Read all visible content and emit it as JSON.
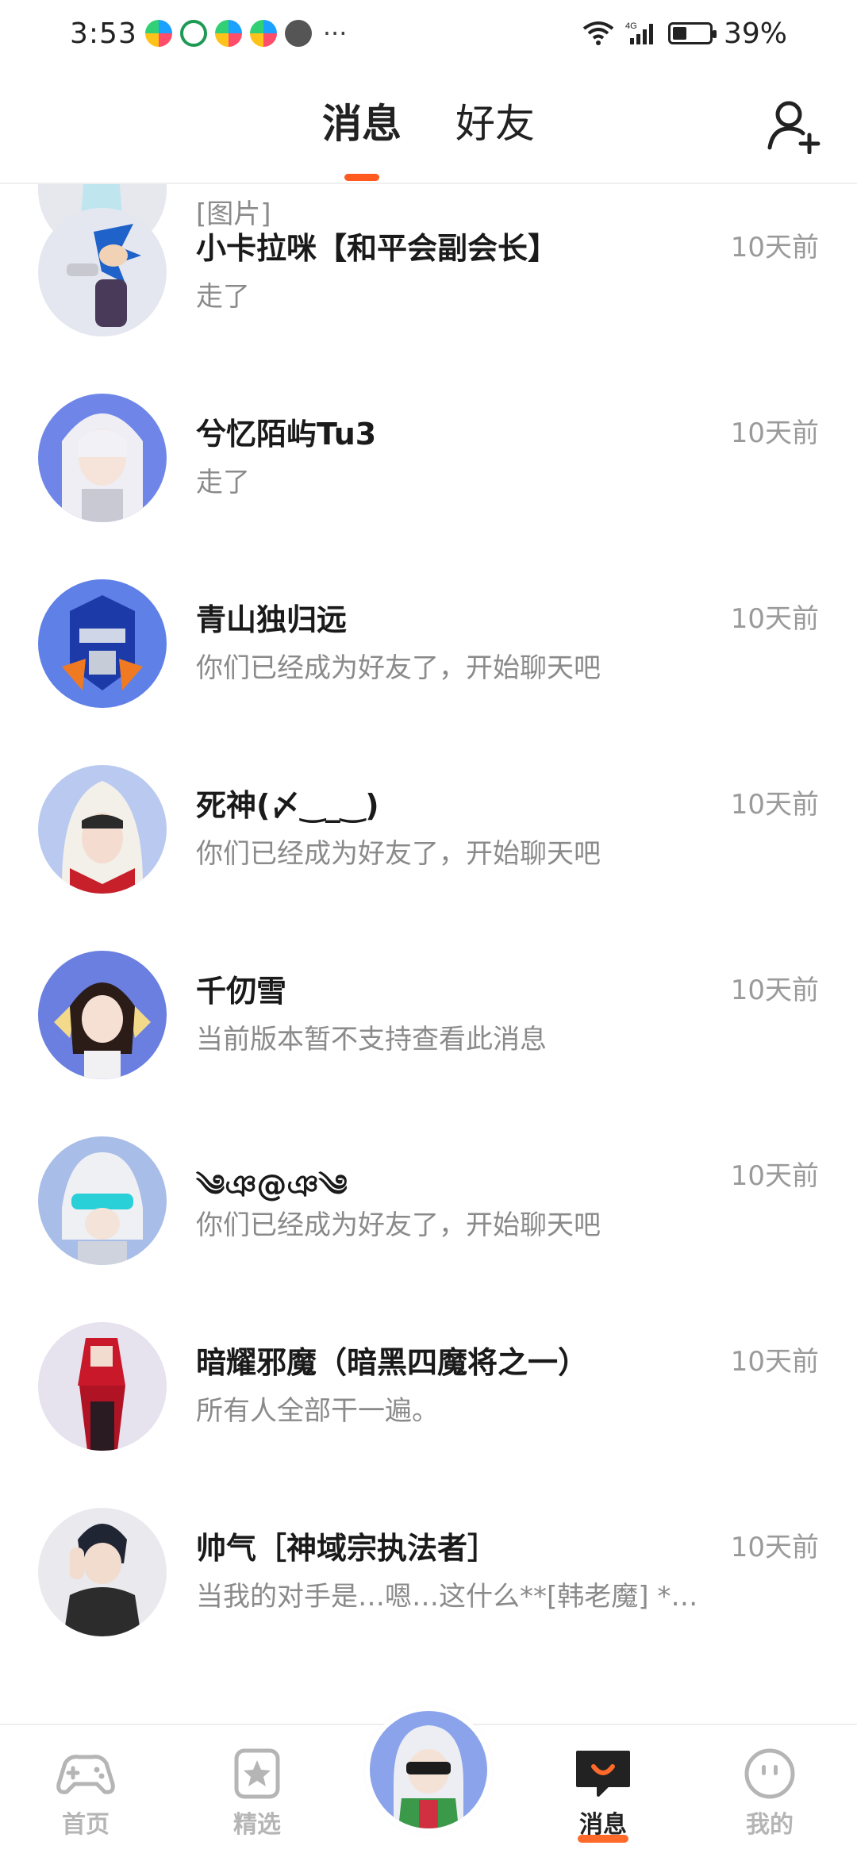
{
  "status_bar": {
    "time": "3:53",
    "network": "4G",
    "battery": "39%",
    "more": "···"
  },
  "header": {
    "tabs": [
      {
        "label": "消息",
        "active": true
      },
      {
        "label": "好友",
        "active": false
      }
    ],
    "add_friend_icon": "add-user-icon"
  },
  "partial_row": {
    "preview": "[图片]"
  },
  "messages": [
    {
      "name": "小卡拉咪【和平会副会长】",
      "preview": "走了",
      "time": "10天前"
    },
    {
      "name": "兮忆陌屿Tu3",
      "preview": "走了",
      "time": "10天前"
    },
    {
      "name": "青山独归远",
      "preview": "你们已经成为好友了，开始聊天吧",
      "time": "10天前"
    },
    {
      "name": "死神(〆‿_‿)",
      "preview": "你们已经成为好友了，开始聊天吧",
      "time": "10天前"
    },
    {
      "name": "千仞雪",
      "preview": "当前版本暂不支持查看此消息",
      "time": "10天前"
    },
    {
      "name": "༄ঞ@ঞ༄",
      "preview": "你们已经成为好友了，开始聊天吧",
      "time": "10天前"
    },
    {
      "name": "暗耀邪魔（暗黑四魔将之一）",
      "preview": "所有人全部干一遍。",
      "time": "10天前"
    },
    {
      "name": "帅气［神域宗执法者］",
      "preview": "当我的对手是…嗯…这什么**[韩老魔] *…",
      "time": "10天前"
    }
  ],
  "bottom_nav": [
    {
      "label": "首页",
      "icon": "gamepad-icon",
      "active": false
    },
    {
      "label": "精选",
      "icon": "star-bookmark-icon",
      "active": false
    },
    {
      "label": "消息",
      "icon": "chat-bubble-icon",
      "active": true
    },
    {
      "label": "我的",
      "icon": "smiley-face-icon",
      "active": false
    }
  ],
  "colors": {
    "accent": "#ff5a1f",
    "text_primary": "#1a1a1a",
    "text_secondary": "#8a8a8a",
    "nav_inactive": "#b5b5b5"
  }
}
